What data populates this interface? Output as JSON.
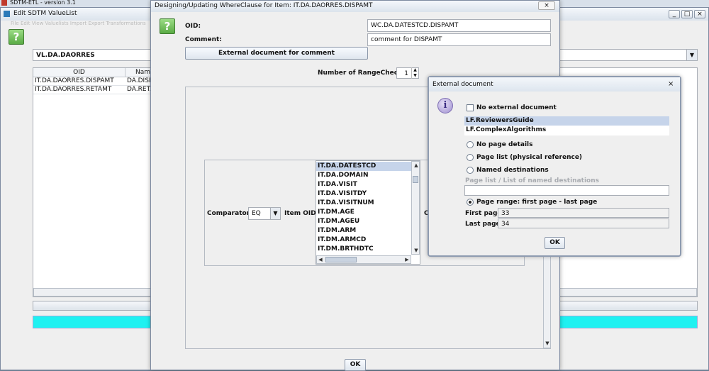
{
  "taskbar": {
    "title": "SDTM-ETL - version 3.1",
    "ghost": "File  Edit  View  Valuelists  Import  Export  Transformations"
  },
  "valuelist_window": {
    "title": "Edit SDTM ValueList",
    "selected": "VL.DA.DAORRES",
    "columns": [
      "OID",
      "Nam"
    ],
    "rows": [
      [
        "IT.DA.DAORRES.DISPAMT",
        "DA.DISP"
      ],
      [
        "IT.DA.DAORRES.RETAMT",
        "DA.RETA"
      ]
    ]
  },
  "whereclause_dialog": {
    "title": "Designing/Updating WhereClause for Item: IT.DA.DAORRES.DISPAMT",
    "oid_label": "OID:",
    "oid_value": "WC.DA.DATESTCD.DISPAMT",
    "comment_label": "Comment:",
    "comment_value": "comment for DISPAMT",
    "ext_doc_button": "External document for comment",
    "rangechecks_label": "Number of RangeChecks:",
    "rangechecks_value": "1",
    "comparator_label": "Comparator:",
    "comparator_value": "EQ",
    "item_oid_label": "Item OID:",
    "item_oids": [
      "IT.DA.DATESTCD",
      "IT.DA.DOMAIN",
      "IT.DA.VISIT",
      "IT.DA.VISITDY",
      "IT.DA.VISITNUM",
      "IT.DM.AGE",
      "IT.DM.AGEU",
      "IT.DM.ARM",
      "IT.DM.ARMCD",
      "IT.DM.BRTHDTC"
    ],
    "clipped_label": "C",
    "ok_button": "OK"
  },
  "extdoc_dialog": {
    "title": "External document",
    "no_ext_doc": "No external document",
    "documents": [
      "LF.ReviewersGuide",
      "LF.ComplexAlgorithms"
    ],
    "opt_no_page": "No page details",
    "opt_page_list": "Page list (physical reference)",
    "opt_named": "Named destinations",
    "page_list_label": "Page list / List of named destinations",
    "opt_page_range": "Page range: first page - last page",
    "first_page_label": "First page:",
    "first_page": "33",
    "last_page_label": "Last page:",
    "last_page": "34",
    "ok_button": "OK"
  },
  "colors": {
    "accent_cyan": "#1ff1f1",
    "selection": "#c6d4ea",
    "help_green": "#5aab45"
  }
}
